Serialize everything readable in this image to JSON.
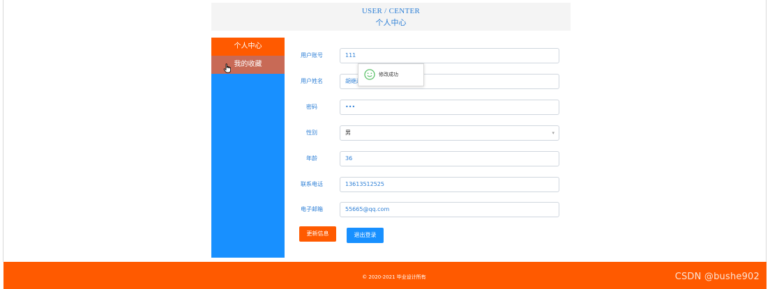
{
  "header": {
    "title_en": "USER / CENTER",
    "title_cn": "个人中心"
  },
  "sidebar": {
    "items": [
      {
        "label": "个人中心",
        "state": "active"
      },
      {
        "label": "我的收藏",
        "state": "hover"
      }
    ]
  },
  "form": {
    "account": {
      "label": "用户账号",
      "value": "111"
    },
    "name": {
      "label": "用户姓名",
      "value": "胡继越"
    },
    "password": {
      "label": "密码",
      "value": "•••"
    },
    "gender": {
      "label": "性别",
      "value": "男"
    },
    "age": {
      "label": "年龄",
      "value": "36"
    },
    "phone": {
      "label": "联系电话",
      "value": "13613512525"
    },
    "email": {
      "label": "电子邮箱",
      "value": "55665@qq.com"
    }
  },
  "toast": {
    "message": "修改成功",
    "icon": "smile-icon"
  },
  "buttons": {
    "update": "更新信息",
    "logout": "退出登录"
  },
  "footer": {
    "copyright": "© 2020-2021 毕业设计所有",
    "watermark": "CSDN @bushe902"
  },
  "colors": {
    "accent_orange": "#ff5a00",
    "accent_blue": "#1890ff",
    "hover_item": "#c86a56",
    "label_blue": "#2d7fd6"
  }
}
